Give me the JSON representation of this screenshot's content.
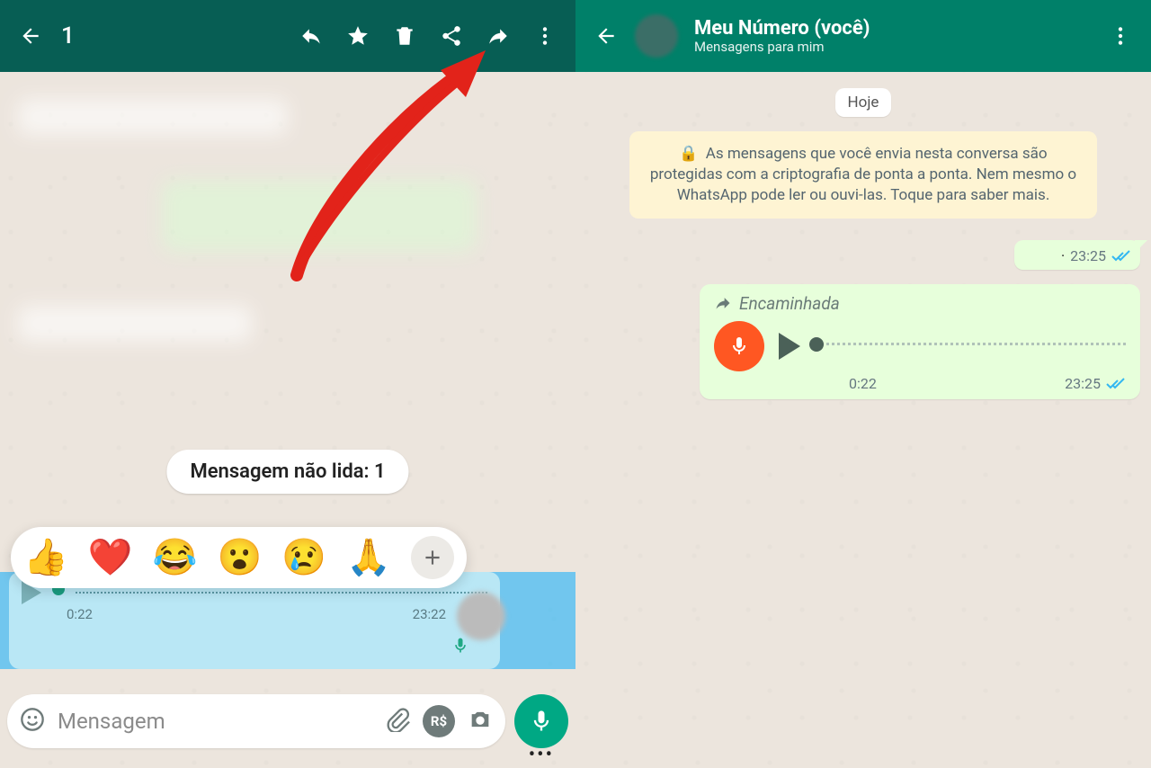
{
  "left": {
    "selection_count": "1",
    "unread_pill": "Mensagem não lida: 1",
    "reactions": {
      "emojis": [
        "👍",
        "❤️",
        "😂",
        "😮",
        "😢",
        "🙏"
      ]
    },
    "selected_voice": {
      "duration": "0:22",
      "time": "23:22"
    },
    "composer": {
      "placeholder": "Mensagem"
    }
  },
  "right": {
    "title": "Meu Número (você)",
    "subtitle": "Mensagens para mim",
    "date_chip": "Hoje",
    "encryption_notice": "As mensagens que você envia nesta conversa são protegidas com a criptografia de ponta a ponta. Nem mesmo o WhatsApp pode ler ou ouvi-las. Toque para saber mais.",
    "msg_small": {
      "time": "23:25"
    },
    "voice_fwd": {
      "label": "Encaminhada",
      "duration": "0:22",
      "time": "23:25"
    }
  }
}
